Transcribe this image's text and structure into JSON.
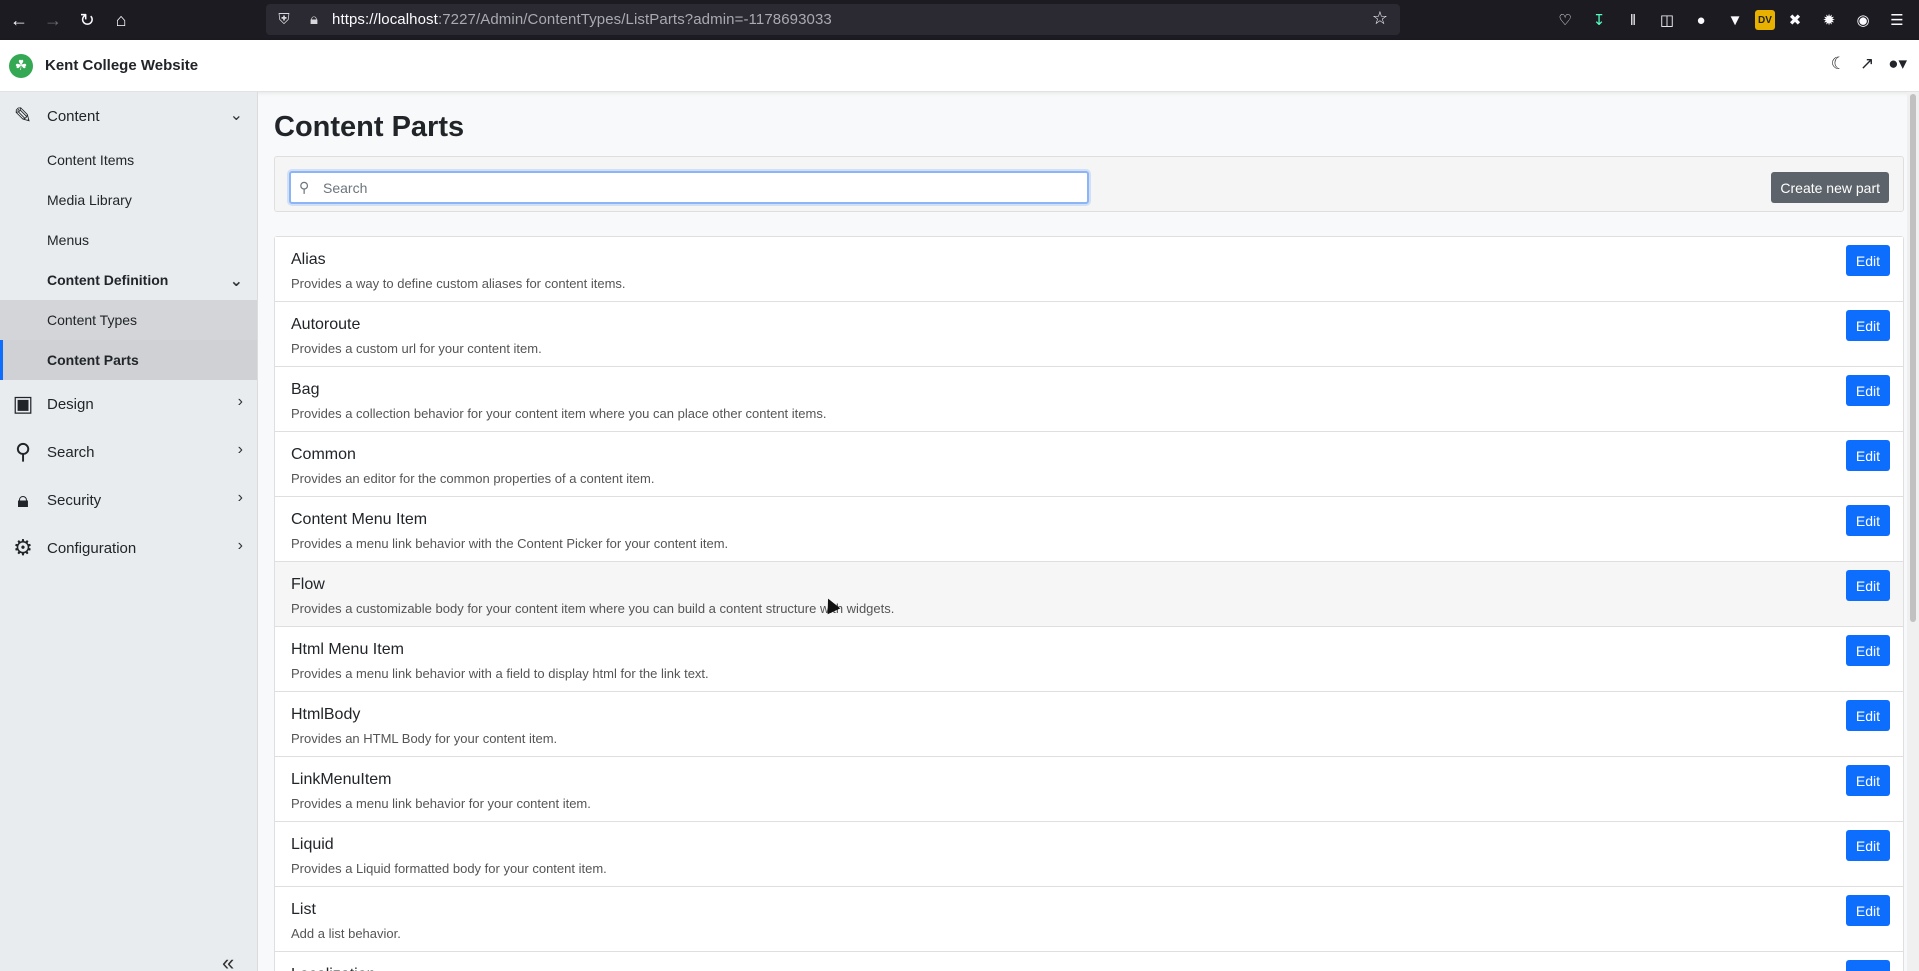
{
  "browser": {
    "url_host": "https://localhost",
    "url_rest": ":7227/Admin/ContentTypes/ListParts?admin=-1178693033",
    "toolbar_icons": [
      "pocket-icon",
      "download-icon",
      "library-icon",
      "sidebar-icon",
      "account-icon",
      "vpn-icon",
      "dv-extension-icon",
      "extension-icon",
      "gear-extension-icon",
      "extension2-icon",
      "menu-icon"
    ],
    "dv_label": "DV"
  },
  "header": {
    "site_name": "Kent College Website"
  },
  "sidebar": {
    "groups": [
      {
        "label": "Content"
      },
      {
        "label": "Design"
      },
      {
        "label": "Search"
      },
      {
        "label": "Security"
      },
      {
        "label": "Configuration"
      }
    ],
    "content_items": [
      {
        "label": "Content Items"
      },
      {
        "label": "Media Library"
      },
      {
        "label": "Menus"
      },
      {
        "label": "Content Definition"
      },
      {
        "label": "Content Types"
      },
      {
        "label": "Content Parts"
      }
    ]
  },
  "main": {
    "title": "Content Parts",
    "search_placeholder": "Search",
    "create_label": "Create new part",
    "edit_label": "Edit",
    "parts": [
      {
        "name": "Alias",
        "desc": "Provides a way to define custom aliases for content items."
      },
      {
        "name": "Autoroute",
        "desc": "Provides a custom url for your content item."
      },
      {
        "name": "Bag",
        "desc": "Provides a collection behavior for your content item where you can place other content items."
      },
      {
        "name": "Common",
        "desc": "Provides an editor for the common properties of a content item."
      },
      {
        "name": "Content Menu Item",
        "desc": "Provides a menu link behavior with the Content Picker for your content item."
      },
      {
        "name": "Flow",
        "desc": "Provides a customizable body for your content item where you can build a content structure with widgets."
      },
      {
        "name": "Html Menu Item",
        "desc": "Provides a menu link behavior with a field to display html for the link text."
      },
      {
        "name": "HtmlBody",
        "desc": "Provides an HTML Body for your content item."
      },
      {
        "name": "LinkMenuItem",
        "desc": "Provides a menu link behavior for your content item."
      },
      {
        "name": "Liquid",
        "desc": "Provides a Liquid formatted body for your content item."
      },
      {
        "name": "List",
        "desc": "Add a list behavior."
      },
      {
        "name": "Localization",
        "desc": ""
      }
    ]
  },
  "colors": {
    "primary": "#0d6efd",
    "secondary": "#5c636a",
    "sidebar_bg": "#e9ecef"
  }
}
